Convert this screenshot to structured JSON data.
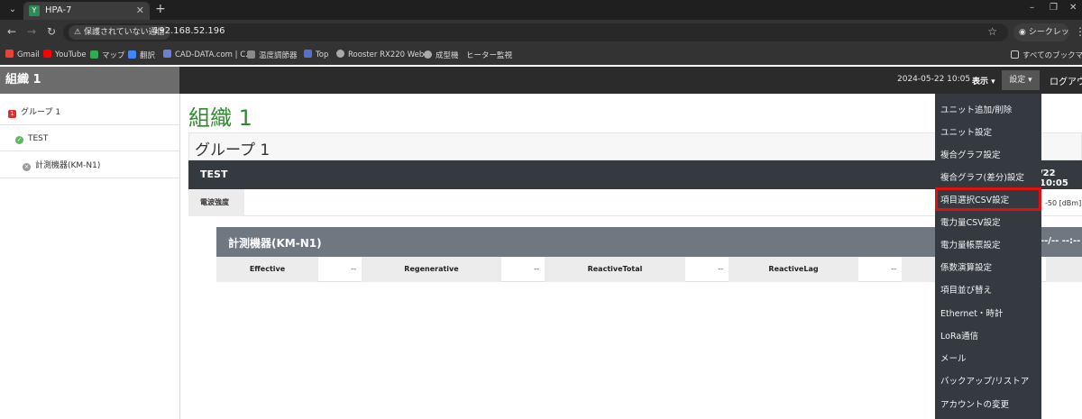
{
  "browser": {
    "tab_title": "HPA-7",
    "tab_favicon": "Y",
    "url": "192.168.52.196",
    "security_chip": "保護されていない通信",
    "incognito_label": "シークレット",
    "bookmarks": [
      {
        "label": "Gmail",
        "color": "#ea4335"
      },
      {
        "label": "YouTube",
        "color": "#ff0000"
      },
      {
        "label": "マップ",
        "color": "#34a853"
      },
      {
        "label": "翻訳",
        "color": "#4285f4"
      },
      {
        "label": "CAD-DATA.com | C...",
        "color": "#6b7fd7"
      },
      {
        "label": "温度調節器",
        "color": "#8a8a8a"
      },
      {
        "label": "Top",
        "color": "#5a6ed0"
      },
      {
        "label": "Rooster RX220 Web...",
        "color": "#aaaaaa"
      },
      {
        "label": "成型機　ヒーター監視",
        "color": "#aaaaaa"
      }
    ],
    "all_bookmarks": "すべてのブックマー"
  },
  "header": {
    "org_name": "組織 1",
    "datetime": "2024-05-22 10:05",
    "view_label": "表示",
    "settings_label": "設定",
    "logout_label": "ログアウ"
  },
  "sidebar": {
    "items": [
      {
        "label": "グループ 1",
        "icon_color": "#d9302f",
        "icon_glyph": "1"
      },
      {
        "label": "TEST",
        "icon_color": "#5cb85c",
        "icon_glyph": "✓"
      },
      {
        "label": "計測機器(KM-N1)",
        "icon_color": "#999999",
        "icon_glyph": "×"
      }
    ]
  },
  "main": {
    "title": "組織 1",
    "group_title": "グループ 1",
    "unit_name": "TEST",
    "unit_time": "/22 10:05",
    "signal_label": "電波強度",
    "signal_value": "-50 [dBm]",
    "device_name": "計測機器(KM-N1)",
    "device_time": "--/-- --:--",
    "measurements": [
      {
        "label": "Effective",
        "value": "--"
      },
      {
        "label": "Regenerative",
        "value": "--"
      },
      {
        "label": "ReactiveTotal",
        "value": "--"
      },
      {
        "label": "ReactiveLag",
        "value": "--"
      }
    ]
  },
  "settings_menu": {
    "items": [
      "ユニット追加/削除",
      "ユニット設定",
      "複合グラフ設定",
      "複合グラフ(差分)設定",
      "項目選択CSV設定",
      "電力量CSV設定",
      "電力量帳票設定",
      "係数演算設定",
      "項目並び替え",
      "Ethernet・時計",
      "LoRa通信",
      "メール",
      "バックアップ/リストア",
      "アカウントの変更"
    ],
    "highlighted_index": 4,
    "highlight_color": "#e01010"
  }
}
